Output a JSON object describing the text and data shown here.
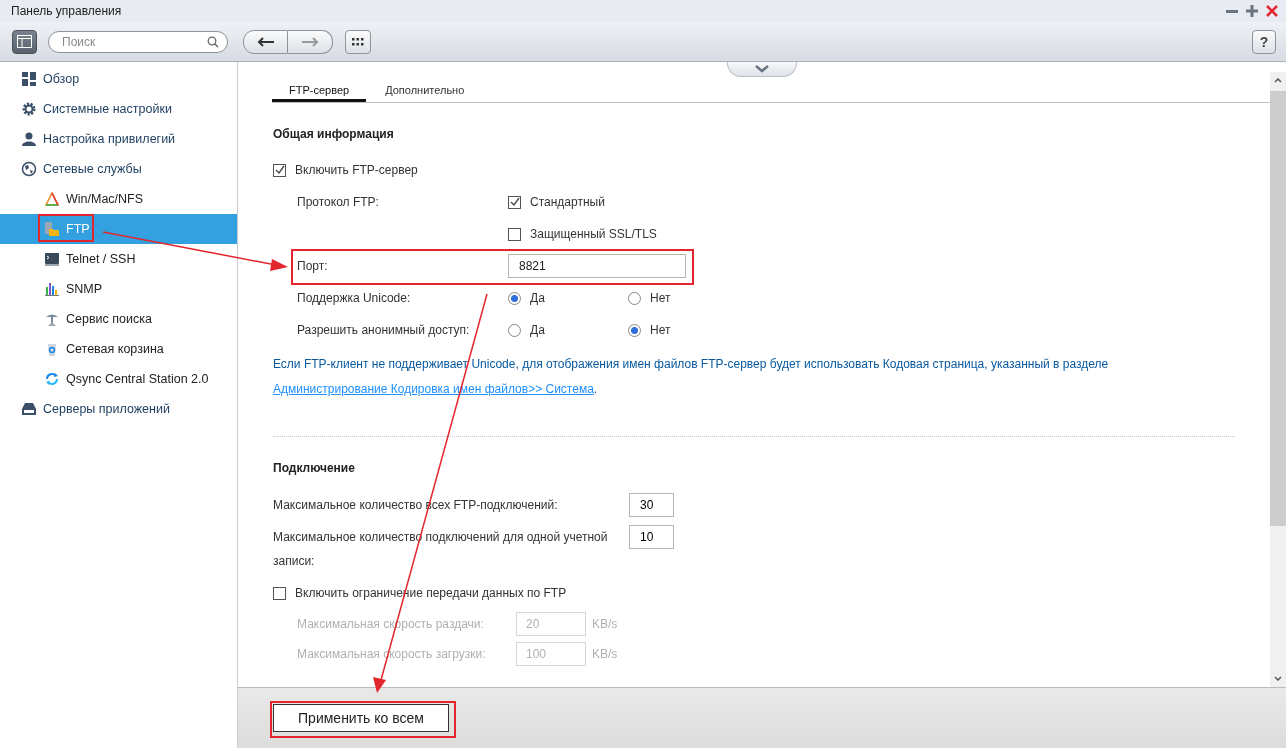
{
  "window": {
    "title": "Панель управления"
  },
  "toolbar": {
    "search": {
      "placeholder": "Поиск"
    },
    "help": "?"
  },
  "sidebar": {
    "items": [
      {
        "label": "Обзор",
        "selected": false
      },
      {
        "label": "Системные настройки",
        "selected": false
      },
      {
        "label": "Настройка привилегий",
        "selected": false
      },
      {
        "label": "Сетевые службы",
        "selected": false,
        "children": [
          {
            "label": "Win/Mac/NFS",
            "selected": false
          },
          {
            "label": "FTP",
            "selected": true
          },
          {
            "label": "Telnet / SSH",
            "selected": false
          },
          {
            "label": "SNMP",
            "selected": false
          },
          {
            "label": "Сервис поиска",
            "selected": false
          },
          {
            "label": "Сетевая корзина",
            "selected": false
          },
          {
            "label": "Qsync Central Station 2.0",
            "selected": false
          }
        ]
      },
      {
        "label": "Серверы приложений",
        "selected": false
      }
    ]
  },
  "tabs": [
    {
      "label": "FTP-сервер",
      "selected": true
    },
    {
      "label": "Дополнительно",
      "selected": false
    }
  ],
  "general": {
    "title": "Общая информация",
    "fields": [
      {
        "kind": "checkbox",
        "label": "Включить FTP-сервер",
        "checked": true
      },
      {
        "kind": "checkgroup",
        "label": "Протокол FTP:",
        "options": [
          {
            "label": "Стандартный",
            "checked": true
          },
          {
            "label": "Защищенный SSL/TLS",
            "checked": false
          }
        ]
      },
      {
        "kind": "input",
        "label": "Порт:",
        "value": "8821"
      },
      {
        "kind": "radio",
        "label": "Поддержка Unicode:",
        "options": [
          {
            "label": "Да",
            "selected": true
          },
          {
            "label": "Нет",
            "selected": false
          }
        ]
      },
      {
        "kind": "radio",
        "label": "Разрешить анонимный доступ:",
        "options": [
          {
            "label": "Да",
            "selected": false
          },
          {
            "label": "Нет",
            "selected": true
          }
        ]
      }
    ],
    "note": {
      "text": "Если FTP-клиент не поддерживает Unicode, для отображения имен файлов FTP-сервер будет использовать Кодовая страница, указанный в разделе",
      "link": "Администрирование Кодировка имен файлов>> Система",
      "after": "."
    }
  },
  "connection": {
    "title": "Подключение",
    "fields": [
      {
        "kind": "number",
        "label": "Максимальное количество всех FTP-подключений:",
        "value": "30",
        "disabled": false
      },
      {
        "kind": "number",
        "label": "Максимальное количество подключений для одной учетной записи:",
        "value": "10",
        "disabled": false
      },
      {
        "kind": "checkbox",
        "label": "Включить ограничение передачи данных по FTP",
        "checked": false
      },
      {
        "kind": "rate",
        "label": "Максимальная скорость раздачи:",
        "value": "20",
        "unit": "KB/s",
        "disabled": true
      },
      {
        "kind": "rate",
        "label": "Максимальная скорость загрузки:",
        "value": "100",
        "unit": "KB/s",
        "disabled": true
      }
    ]
  },
  "footer": {
    "apply": "Применить ко всем"
  }
}
